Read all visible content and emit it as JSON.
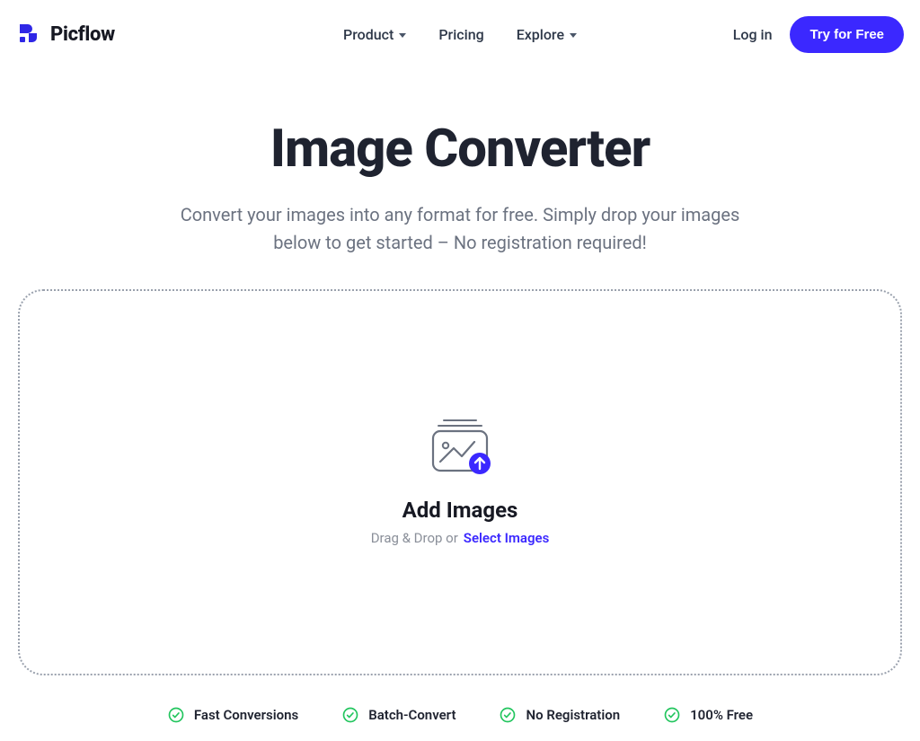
{
  "brand": {
    "name": "Picflow"
  },
  "nav": {
    "product": "Product",
    "pricing": "Pricing",
    "explore": "Explore",
    "login": "Log in",
    "cta": "Try for Free"
  },
  "hero": {
    "title": "Image Converter",
    "subtitle": "Convert your images into any format for free. Simply drop your images below to get started – No registration required!"
  },
  "dropzone": {
    "title": "Add Images",
    "drag_text": "Drag & Drop or",
    "select_link": "Select Images"
  },
  "features": {
    "items": [
      "Fast Conversions",
      "Batch-Convert",
      "No Registration",
      "100% Free"
    ]
  },
  "colors": {
    "primary": "#3b28ff",
    "success": "#22c55e"
  }
}
